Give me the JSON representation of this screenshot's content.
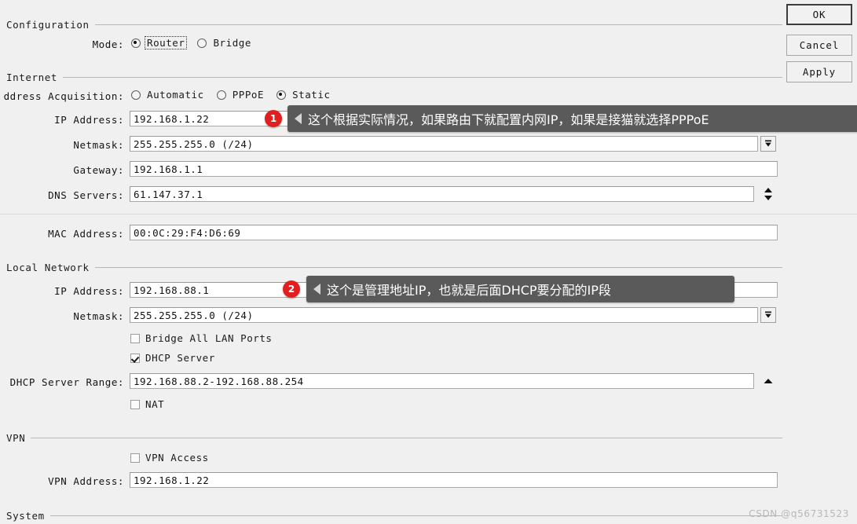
{
  "buttons": {
    "ok": "OK",
    "cancel": "Cancel",
    "apply": "Apply"
  },
  "sections": {
    "configuration": "Configuration",
    "internet": "Internet",
    "local_network": "Local Network",
    "vpn": "VPN",
    "system": "System"
  },
  "configuration": {
    "mode_label": "Mode:",
    "mode_options": [
      {
        "label": "Router",
        "selected": true,
        "focused": true
      },
      {
        "label": "Bridge",
        "selected": false,
        "focused": false
      }
    ]
  },
  "internet": {
    "acquisition_label": "ddress Acquisition:",
    "acquisition_options": [
      {
        "label": "Automatic",
        "selected": false
      },
      {
        "label": "PPPoE",
        "selected": false
      },
      {
        "label": "Static",
        "selected": true
      }
    ],
    "ip_address_label": "IP Address:",
    "ip_address_value": "192.168.1.22",
    "netmask_label": "Netmask:",
    "netmask_value": "255.255.255.0 (/24)",
    "gateway_label": "Gateway:",
    "gateway_value": "192.168.1.1",
    "dns_label": "DNS Servers:",
    "dns_value": "61.147.37.1",
    "mac_label": "MAC Address:",
    "mac_value": "00:0C:29:F4:D6:69"
  },
  "local_network": {
    "ip_address_label": "IP Address:",
    "ip_address_value": "192.168.88.1",
    "netmask_label": "Netmask:",
    "netmask_value": "255.255.255.0 (/24)",
    "bridge_all_lan_label": "Bridge All LAN Ports",
    "bridge_all_lan_checked": false,
    "dhcp_server_label": "DHCP Server",
    "dhcp_server_checked": true,
    "dhcp_range_label": "DHCP Server Range:",
    "dhcp_range_value": "192.168.88.2-192.168.88.254",
    "nat_label": "NAT",
    "nat_checked": false
  },
  "vpn": {
    "vpn_access_label": "VPN Access",
    "vpn_access_checked": false,
    "vpn_address_label": "VPN Address:",
    "vpn_address_value": "192.168.1.22"
  },
  "callouts": [
    {
      "number": "1",
      "text": "这个根据实际情况，如果路由下就配置内网IP，如果是接猫就选择PPPoE"
    },
    {
      "number": "2",
      "text": "这个是管理地址IP，也就是后面DHCP要分配的IP段"
    }
  ],
  "icons": {
    "dropdown_netmask_internet": "dropdown-arrow-icon",
    "dropdown_netmask_local": "dropdown-arrow-icon",
    "dns_spinner": "up-down-spinner-icon",
    "dhcp_range_spinner": "up-arrow-icon"
  },
  "watermark": "CSDN @q56731523",
  "colors": {
    "accent_badge": "#e02020",
    "callout_bg": "#5a5a5a",
    "window_bg": "#f0f0f0"
  }
}
